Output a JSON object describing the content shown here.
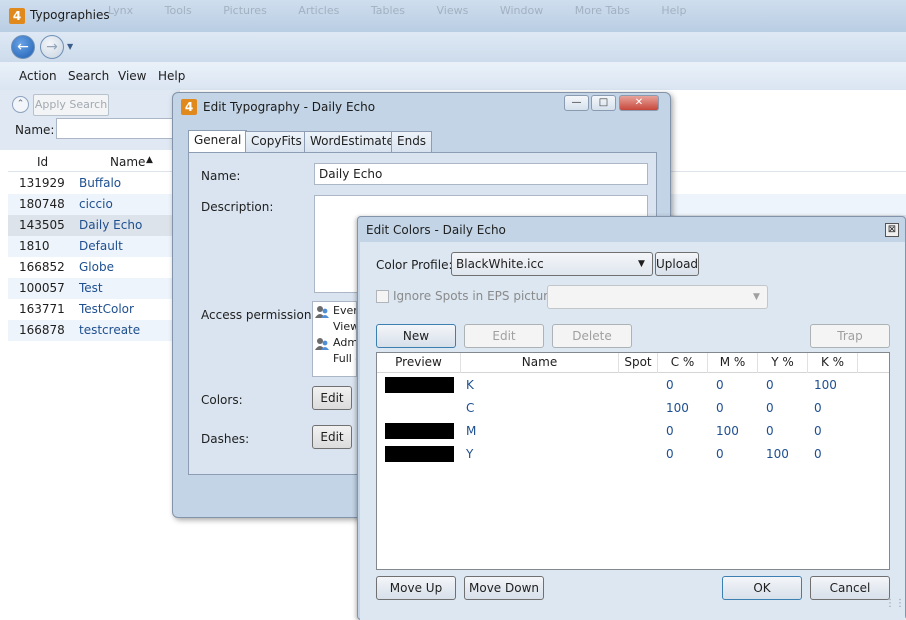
{
  "main_window": {
    "title": "Typographies",
    "app_icon_glyph": "4",
    "background_menu": [
      "Lynx",
      "Tools",
      "Pictures",
      "Articles",
      "Tables",
      "Views",
      "Window",
      "More Tabs",
      "Help"
    ]
  },
  "nav": {
    "back_icon": "back-arrow-icon",
    "forward_icon": "forward-arrow-icon"
  },
  "menubar": [
    "Action",
    "Search",
    "View",
    "Help"
  ],
  "search_panel": {
    "apply_search_label": "Apply Search",
    "name_label": "Name:",
    "name_value": ""
  },
  "typographies_grid": {
    "columns": [
      "Id",
      "Name"
    ],
    "sort_indicator": "▲",
    "rows": [
      {
        "id": "131929",
        "name": "Buffalo"
      },
      {
        "id": "180748",
        "name": "ciccio"
      },
      {
        "id": "143505",
        "name": "Daily Echo"
      },
      {
        "id": "1810",
        "name": "Default"
      },
      {
        "id": "166852",
        "name": "Globe"
      },
      {
        "id": "100057",
        "name": "Test"
      },
      {
        "id": "163771",
        "name": "TestColor"
      },
      {
        "id": "166878",
        "name": "testcreate"
      }
    ],
    "selected_index": 2
  },
  "edit_typography": {
    "title": "Edit Typography - Daily Echo",
    "tabs": [
      "General",
      "CopyFits",
      "WordEstimate",
      "Ends"
    ],
    "active_tab": "General",
    "name_label": "Name:",
    "name_value": "Daily Echo",
    "description_label": "Description:",
    "description_value": "",
    "access_label": "Access permissions:",
    "permissions": [
      {
        "line1": "Every",
        "line2": "View"
      },
      {
        "line1": "Adm",
        "line2": "Full c"
      }
    ],
    "colors_label": "Colors:",
    "dashes_label": "Dashes:",
    "edit_label": "Edit"
  },
  "edit_colors": {
    "title": "Edit Colors - Daily Echo",
    "close_glyph": "⊠",
    "color_profile_label": "Color Profile:",
    "color_profile_value": "BlackWhite.icc",
    "upload_label": "Upload",
    "ignore_spots_label": "Ignore Spots in EPS pictures",
    "ignore_spots_checked": false,
    "buttons": {
      "new": "New",
      "edit": "Edit",
      "delete": "Delete",
      "trap": "Trap"
    },
    "table_columns": [
      "Preview",
      "Name",
      "Spot",
      "C %",
      "M %",
      "Y %",
      "K %"
    ],
    "colors": [
      {
        "has_swatch": true,
        "name": "K",
        "spot": "",
        "c": "0",
        "m": "0",
        "y": "0",
        "k": "100"
      },
      {
        "has_swatch": false,
        "name": "C",
        "spot": "",
        "c": "100",
        "m": "0",
        "y": "0",
        "k": "0"
      },
      {
        "has_swatch": true,
        "name": "M",
        "spot": "",
        "c": "0",
        "m": "100",
        "y": "0",
        "k": "0"
      },
      {
        "has_swatch": true,
        "name": "Y",
        "spot": "",
        "c": "0",
        "m": "0",
        "y": "100",
        "k": "0"
      }
    ],
    "move_up_label": "Move Up",
    "move_down_label": "Move Down",
    "ok_label": "OK",
    "cancel_label": "Cancel"
  }
}
